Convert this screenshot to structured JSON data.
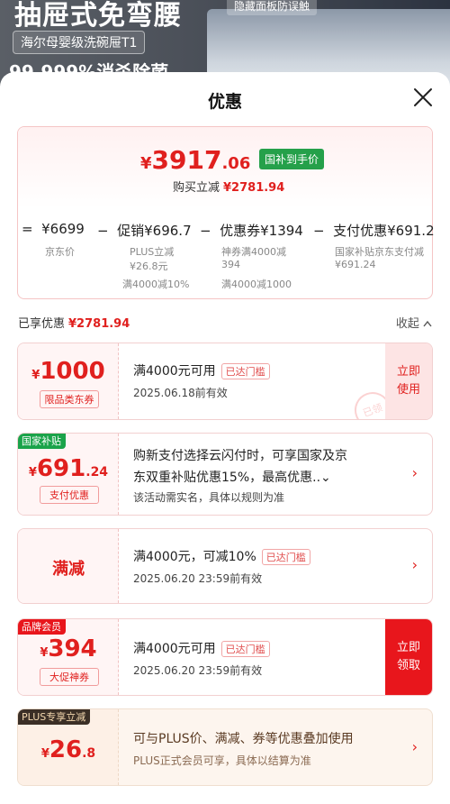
{
  "banner": {
    "headline": "抽屉式免弯腰",
    "subline": "海尔母婴级洗碗屉T1",
    "tag": "99.999%消杀除菌",
    "top_tag": "隐藏面板防误触"
  },
  "sheet": {
    "title": "优惠"
  },
  "summary": {
    "price_symbol": "¥",
    "price_int": "3917",
    "price_dec": ".06",
    "price_tag": "国补到手价",
    "buy_reduce_label": "购买立减",
    "buy_reduce_amount": "¥2781.94",
    "calc": [
      {
        "op": "=",
        "value": "¥6699",
        "sub1": "京东价",
        "sub2": "",
        "sub3": ""
      },
      {
        "op": "−",
        "value": "促销¥696.7",
        "sub1": "PLUS立减",
        "sub2": "¥26.8元",
        "sub3": "满4000减10%"
      },
      {
        "op": "−",
        "value": "优惠券¥1394",
        "sub1": "神券满4000减",
        "sub2": "394",
        "sub3": "满4000减1000"
      },
      {
        "op": "−",
        "value": "支付优惠¥691.2",
        "sub1": "国家补贴京东支付减",
        "sub2": "¥691.24",
        "sub3": ""
      }
    ]
  },
  "enjoyed": {
    "label": "已享优惠",
    "amount": "¥2781.94",
    "collapse": "收起"
  },
  "coupons": [
    {
      "amount_symbol": "¥",
      "amount_big": "1000",
      "amount_dec": "",
      "type": "限品类东券",
      "title": "满4000元可用",
      "reached": "已达门槛",
      "sub": "2025.06.18前有效",
      "action": "立即\n使用",
      "stamp": "已领"
    },
    {
      "badge": "国家补贴",
      "amount_symbol": "¥",
      "amount_big": "691",
      "amount_dec": ".24",
      "type": "支付优惠",
      "title": "购新支付选择云闪付时，可享国家及京",
      "title2": "东双重补贴优惠15%，最高优惠..⌄",
      "sub": "该活动需实名，具体以规则为准",
      "chevron": "›"
    },
    {
      "type_text": "满减",
      "title": "满4000元，可减10%",
      "reached": "已达门槛",
      "sub": "2025.06.20 23:59前有效",
      "chevron": "›"
    },
    {
      "badge": "品牌会员",
      "amount_symbol": "¥",
      "amount_big": "394",
      "amount_dec": "",
      "type": "大促神券",
      "title": "满4000元可用",
      "reached": "已达门槛",
      "sub": "2025.06.20 23:59前有效",
      "action": "立即\n领取"
    },
    {
      "badge": "PLUS专享立减",
      "amount_symbol": "¥",
      "amount_big": "26",
      "amount_dec": ".8",
      "title": "可与PLUS价、满减、券等优惠叠加使用",
      "sub": "PLUS正式会员可享，具体以结算为准",
      "chevron": "›"
    }
  ],
  "colors": {
    "accent_red": "#e0201e",
    "green_tag": "#25a04a",
    "badge_green": "#1aa34a",
    "badge_red": "#e8161c",
    "badge_plus": "#3b2f26"
  }
}
